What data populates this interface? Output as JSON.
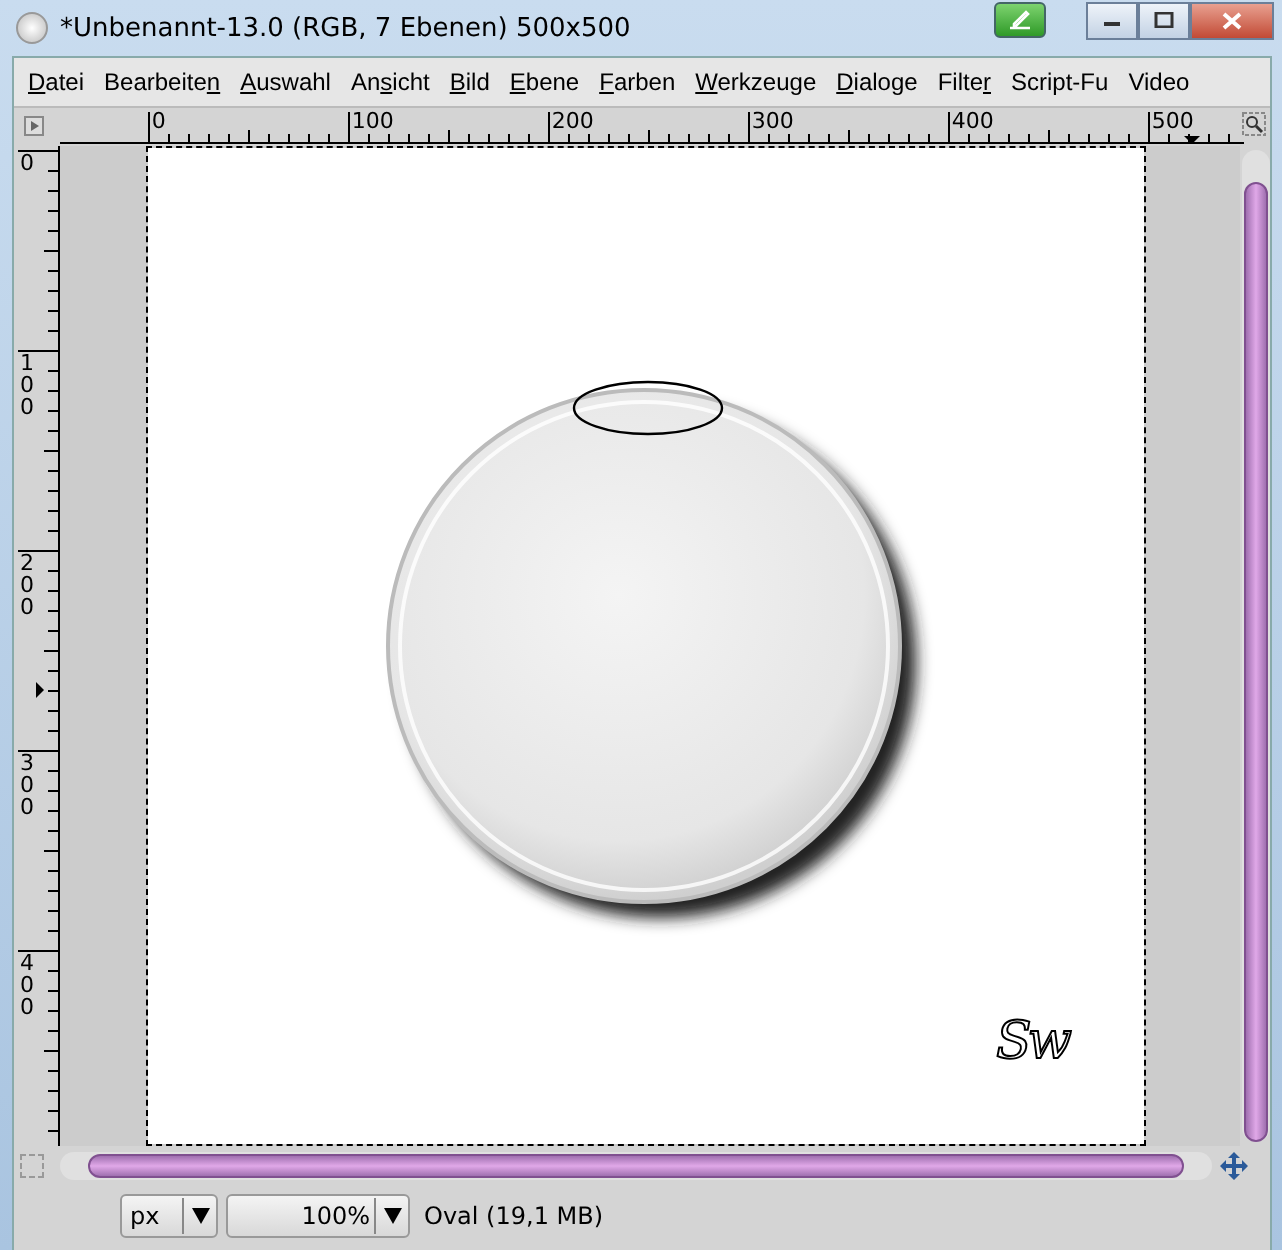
{
  "window": {
    "title": "*Unbenannt-13.0 (RGB, 7 Ebenen) 500x500"
  },
  "menu": [
    {
      "key": "D",
      "post": "atei"
    },
    {
      "pre": "Bearbeite",
      "key": "n"
    },
    {
      "key": "A",
      "post": "uswahl"
    },
    {
      "pre": "An",
      "key": "s",
      "post": "icht"
    },
    {
      "key": "B",
      "post": "ild"
    },
    {
      "key": "E",
      "post": "bene"
    },
    {
      "key": "F",
      "post": "arben"
    },
    {
      "key": "W",
      "post": "erkzeuge"
    },
    {
      "key": "D",
      "post": "ialoge"
    },
    {
      "pre": "Filte",
      "key": "r"
    },
    {
      "pre": "Script-Fu"
    },
    {
      "pre": "Video"
    }
  ],
  "ruler_h": [
    "0",
    "100",
    "200",
    "300",
    "400",
    "500"
  ],
  "ruler_v": [
    "0",
    "100",
    "200",
    "300",
    "400"
  ],
  "canvas": {
    "signature": "Sw"
  },
  "status": {
    "unit": "px",
    "zoom": "100%",
    "info": "Oval (19,1 MB)"
  }
}
